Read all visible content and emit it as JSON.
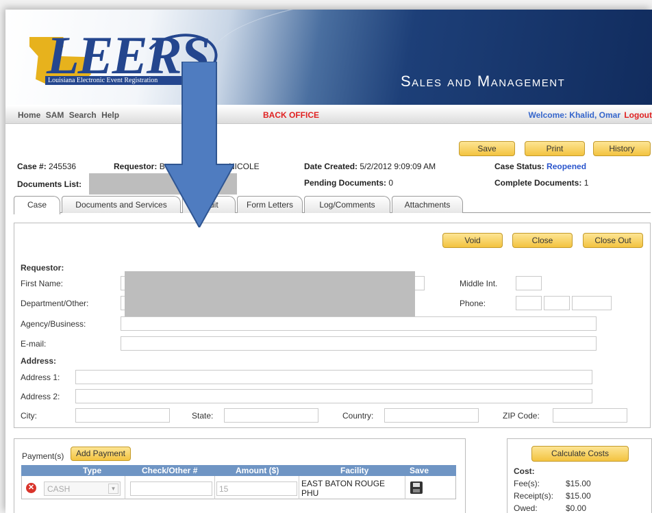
{
  "header": {
    "logo_text": "LEERS",
    "logo_subtitle": "Louisiana Electronic Event Registration",
    "app_title": "Sales and Management"
  },
  "nav": {
    "links": [
      "Home",
      "SAM",
      "Search",
      "Help"
    ],
    "office": "BACK OFFICE",
    "welcome": "Welcome: Khalid, Omar",
    "logout": "Logout"
  },
  "toolbar": {
    "save": "Save",
    "print": "Print",
    "history": "History"
  },
  "case": {
    "case_label": "Case #:",
    "case_number": "245536",
    "requestor_label": "Requestor:",
    "requestor_value_a": "B",
    "requestor_value_b": "NICOLE",
    "date_label": "Date Created:",
    "date_value": "5/2/2012 9:09:09 AM",
    "status_label": "Case Status:",
    "status_value": "Reopened",
    "documents_list_label": "Documents List:",
    "pending_label": "Pending Documents:",
    "pending_value": "0",
    "complete_label": "Complete Documents:",
    "complete_value": "1"
  },
  "tabs": [
    "Case",
    "Documents and Services",
    "Audit",
    "Form Letters",
    "Log/Comments",
    "Attachments"
  ],
  "case_actions": {
    "void": "Void",
    "close": "Close",
    "close_out": "Close Out"
  },
  "form": {
    "requestor_heading": "Requestor:",
    "first_name": "First Name:",
    "middle_int": "Middle Int.",
    "department": "Department/Other:",
    "phone": "Phone:",
    "agency": "Agency/Business:",
    "email": "E-mail:",
    "address_heading": "Address:",
    "address1": "Address 1:",
    "address2": "Address 2:",
    "city": "City:",
    "state": "State:",
    "country": "Country:",
    "zip": "ZIP Code:"
  },
  "payments": {
    "label": "Payment(s)",
    "add_button": "Add Payment",
    "columns": [
      "Type",
      "Check/Other #",
      "Amount ($)",
      "Facility",
      "Save"
    ],
    "row": {
      "type": "CASH",
      "check": "",
      "amount": "15",
      "facility": "EAST BATON ROUGE PHU"
    }
  },
  "cost": {
    "calculate_button": "Calculate Costs",
    "heading": "Cost:",
    "fees_label": "Fee(s):",
    "fees_value": "$15.00",
    "receipts_label": "Receipt(s):",
    "receipts_value": "$15.00",
    "owed_label": "Owed:",
    "owed_value": "$0.00"
  },
  "colors": {
    "accent": "#f3c340",
    "nav_red": "#e02020",
    "nav_blue": "#3566cc",
    "table_head": "#6f95c4",
    "arrow": "#4f7cc0"
  }
}
